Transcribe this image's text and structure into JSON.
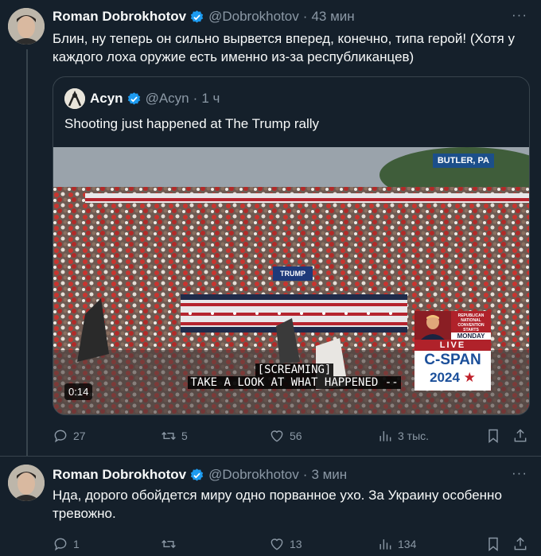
{
  "tweets": [
    {
      "author": "Roman Dobrokhotov",
      "handle": "@Dobrokhotov",
      "time": "43 мин",
      "text": "Блин, ну теперь он сильно вырвется вперед, конечно, типа герой! (Хотя у каждого лоха оружие есть именно из-за республиканцев)",
      "quote": {
        "author": "Acyn",
        "handle": "@Acyn",
        "time": "1 ч",
        "text": "Shooting just happened at The Trump rally",
        "video": {
          "location_badge": "BUTLER, PA",
          "caption_line1": "[SCREAMING]",
          "caption_line2": "TAKE A LOOK AT WHAT HAPPENED --",
          "duration": "0:14",
          "lower_banner": "TRUMP",
          "network": {
            "convention": "REPUBLICAN NATIONAL CONVENTION",
            "starts": "STARTS",
            "day": "MONDAY",
            "live": "LIVE",
            "logo": "C-SPAN",
            "year": "2024"
          }
        }
      },
      "stats": {
        "replies": "27",
        "reposts": "5",
        "likes": "56",
        "views": "3 тыс."
      }
    },
    {
      "author": "Roman Dobrokhotov",
      "handle": "@Dobrokhotov",
      "time": "3 мин",
      "text": "Нда, дорого обойдется миру одно порванное ухо. За Украину особенно тревожно.",
      "stats": {
        "replies": "1",
        "reposts": "",
        "likes": "13",
        "views": "134"
      }
    }
  ],
  "ui": {
    "more": "···",
    "dot": "·"
  },
  "colors": {
    "background": "#15202b",
    "text": "#f7f9f9",
    "muted": "#8b98a5",
    "border": "#38444d",
    "verified": "#1d9bf0"
  }
}
